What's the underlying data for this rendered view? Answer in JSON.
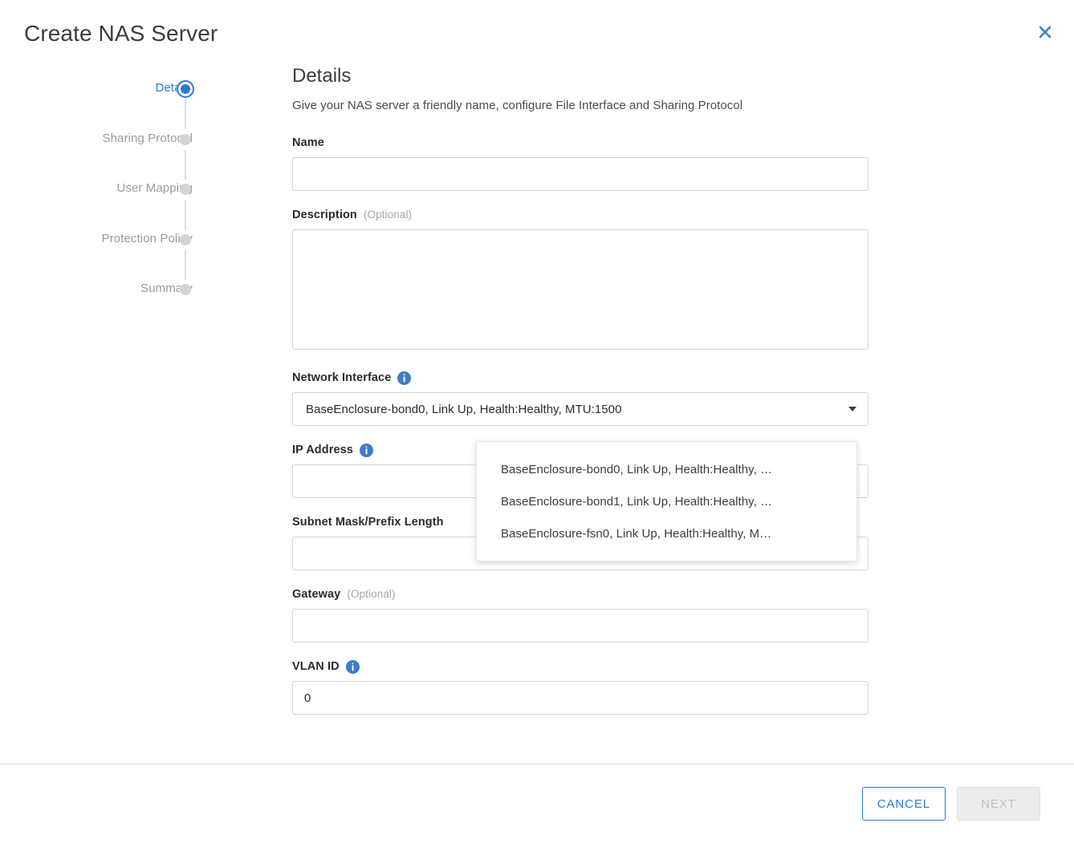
{
  "header": {
    "title": "Create NAS Server",
    "close_label": "Close"
  },
  "stepper": {
    "steps": [
      {
        "label": "Details",
        "state": "active"
      },
      {
        "label": "Sharing Protocol",
        "state": "pending"
      },
      {
        "label": "User Mapping",
        "state": "pending"
      },
      {
        "label": "Protection Policy",
        "state": "pending"
      },
      {
        "label": "Summary",
        "state": "pending"
      }
    ]
  },
  "panel": {
    "title": "Details",
    "subtitle": "Give your NAS server a friendly name, configure File Interface and Sharing Protocol"
  },
  "fields": {
    "name": {
      "label": "Name",
      "value": "",
      "placeholder": ""
    },
    "description": {
      "label": "Description",
      "optional": "(Optional)",
      "value": "",
      "placeholder": ""
    },
    "network_interface": {
      "label": "Network Interface",
      "info_icon": "info-icon",
      "selected": "BaseEnclosure-bond0, Link Up, Health:Healthy, MTU:1500",
      "options": [
        "BaseEnclosure-bond0, Link Up, Health:Healthy, …",
        "BaseEnclosure-bond1, Link Up, Health:Healthy, …",
        "BaseEnclosure-fsn0, Link Up, Health:Healthy, M…"
      ]
    },
    "ip_address": {
      "label": "IP Address",
      "info_icon": "info-icon",
      "value": "",
      "placeholder": ""
    },
    "subnet_mask": {
      "label": "Subnet Mask/Prefix Length",
      "value": "",
      "placeholder": ""
    },
    "gateway": {
      "label": "Gateway",
      "optional": "(Optional)",
      "value": "",
      "placeholder": ""
    },
    "vlan_id": {
      "label": "VLAN ID",
      "info_icon": "info-icon",
      "value": "0",
      "placeholder": ""
    }
  },
  "footer": {
    "cancel_label": "CANCEL",
    "next_label": "NEXT"
  },
  "colors": {
    "accent": "#2d7ad4",
    "text": "#2b2b2b",
    "muted": "#9a9a9a",
    "border": "#d5d5d5",
    "disabled_bg": "#ececec"
  }
}
